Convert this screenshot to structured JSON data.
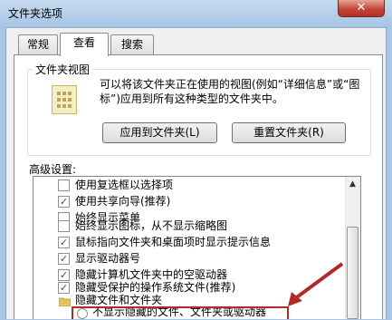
{
  "window": {
    "title": "文件夹选项",
    "close_glyph": "✕"
  },
  "tabs": [
    {
      "label": "常规",
      "active": false
    },
    {
      "label": "查看",
      "active": true
    },
    {
      "label": "搜索",
      "active": false
    }
  ],
  "folder_view": {
    "group_title": "文件夹视图",
    "icon": "folder-view-icon",
    "description": "可以将该文件夹正在使用的视图(例如“详细信息”或“图标”)应用到所有这种类型的文件夹中。",
    "apply_button": "应用到文件夹(L)",
    "reset_button": "重置文件夹(R)"
  },
  "advanced": {
    "label": "高级设置:",
    "items": [
      {
        "label": "使用复选框以选择项",
        "checked": false
      },
      {
        "label": "使用共享向导(推荐)",
        "checked": true
      },
      {
        "label": "始终显示菜单",
        "checked": false
      },
      {
        "label": "始终显示图标，从不显示缩略图",
        "checked": false
      },
      {
        "label": "鼠标指向文件夹和桌面项时显示提示信息",
        "checked": true
      },
      {
        "label": "显示驱动器号",
        "checked": true
      },
      {
        "label": "隐藏计算机文件夹中的空驱动器",
        "checked": true
      },
      {
        "label": "隐藏受保护的操作系统文件(推荐)",
        "checked": true
      },
      {
        "label": "隐藏文件和文件夹",
        "icon": "folder-icon"
      },
      {
        "label": "不显示隐藏的文件、文件夹或驱动器",
        "radio": true
      }
    ],
    "check_glyph": "✓"
  },
  "scrollbar": {
    "up_glyph": "▲"
  },
  "colors": {
    "annotation_red": "#b32a2a",
    "titlebar": "#a7c4e4",
    "close": "#c4463a"
  }
}
